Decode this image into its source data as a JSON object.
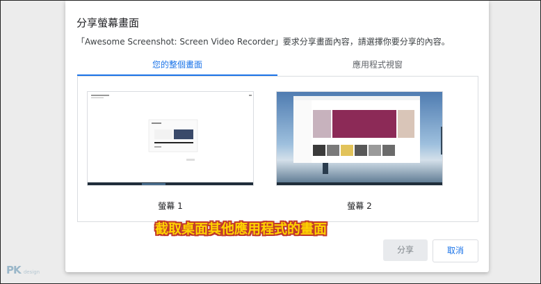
{
  "dialog": {
    "title": "分享螢幕畫面",
    "description": "「Awesome Screenshot: Screen Video Recorder」要求分享畫面內容，請選擇你要分享的內容。",
    "tabs": [
      {
        "label": "您的整個畫面"
      },
      {
        "label": "應用程式視窗"
      }
    ],
    "screens": [
      {
        "label": "螢幕 1"
      },
      {
        "label": "螢幕 2"
      }
    ],
    "buttons": {
      "share": "分享",
      "cancel": "取消"
    }
  },
  "overlay": {
    "caption": "截取桌面其他應用程式的畫面",
    "watermark": "PK",
    "watermark_small": "design"
  },
  "colors": {
    "accent": "#1a73e8",
    "caption_fill": "#ffd400",
    "caption_outline": "#c0392b"
  }
}
